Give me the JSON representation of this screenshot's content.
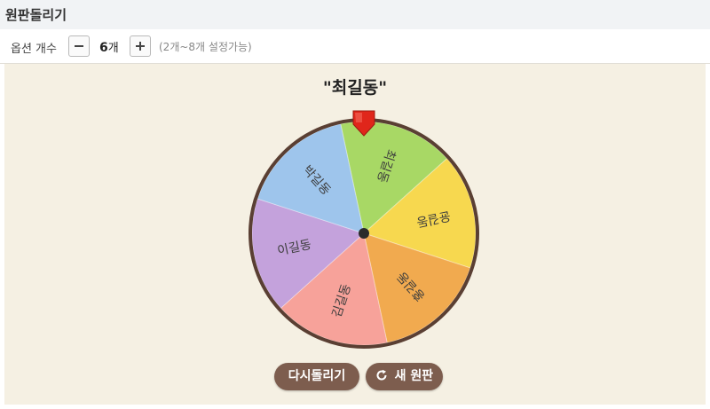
{
  "header": {
    "title": "원판돌리기"
  },
  "options": {
    "label": "옵션 개수",
    "count_number": "6",
    "count_unit": "개",
    "hint": "(2개~8개 설정가능)",
    "minus_icon": "minus-icon",
    "plus_icon": "plus-icon"
  },
  "result": "\"최길동\"",
  "wheel": {
    "pointer_icon": "pointer-marker-icon",
    "colors": {
      "rim": "#5a3f33",
      "hub": "#2b2b2b",
      "pointer": "#e0261b"
    },
    "segments": [
      {
        "label": "최길동",
        "color": "#a8d865"
      },
      {
        "label": "윤길동",
        "color": "#f7d84f"
      },
      {
        "label": "홍길동",
        "color": "#f1aa4f"
      },
      {
        "label": "김길동",
        "color": "#f7a29a"
      },
      {
        "label": "이길동",
        "color": "#c4a2dc"
      },
      {
        "label": "박길동",
        "color": "#9ec5ec"
      }
    ]
  },
  "buttons": {
    "respin": "다시돌리기",
    "new_wheel": "새 원판",
    "new_wheel_icon": "refresh-icon"
  }
}
